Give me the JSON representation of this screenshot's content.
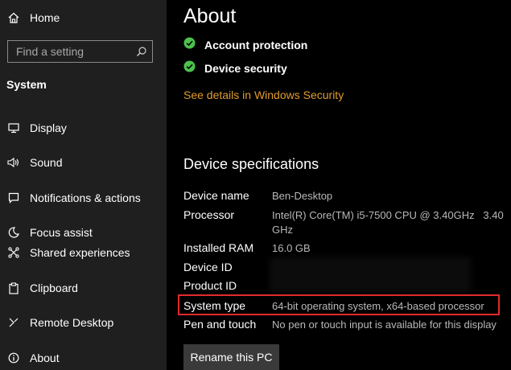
{
  "sidebar": {
    "home_label": "Home",
    "search_placeholder": "Find a setting",
    "section_title": "System",
    "items": [
      {
        "label": "Display",
        "icon": "display-icon"
      },
      {
        "label": "Sound",
        "icon": "speaker-icon"
      },
      {
        "label": "Notifications & actions",
        "icon": "notifications-icon"
      },
      {
        "label": "Focus assist",
        "icon": "moon-icon"
      },
      {
        "label": "Shared experiences",
        "icon": "shared-experiences-icon"
      },
      {
        "label": "Clipboard",
        "icon": "clipboard-icon"
      },
      {
        "label": "Remote Desktop",
        "icon": "remote-desktop-icon"
      },
      {
        "label": "About",
        "icon": "info-icon"
      }
    ]
  },
  "main": {
    "title": "About",
    "security": [
      {
        "label": "Account protection",
        "status_color": "#4cc24c"
      },
      {
        "label": "Device security",
        "status_color": "#4cc24c"
      }
    ],
    "security_link": "See details in Windows Security",
    "specs_heading": "Device specifications",
    "specs": [
      {
        "label": "Device name",
        "value": "Ben-Desktop"
      },
      {
        "label": "Processor",
        "value_line1": "Intel(R) Core(TM) i5-7500 CPU @ 3.40GHz   3.40",
        "value_line2": "GHz"
      },
      {
        "label": "Installed RAM",
        "value": "16.0 GB"
      },
      {
        "label": "Device ID",
        "value": ""
      },
      {
        "label": "Product ID",
        "value": ""
      },
      {
        "label": "System type",
        "value": "64-bit operating system, x64-based processor"
      },
      {
        "label": "Pen and touch",
        "value": "No pen or touch input is available for this display"
      }
    ],
    "rename_button": "Rename this PC"
  },
  "colors": {
    "sidebar_bg": "#1f1f1f",
    "main_bg": "#000000",
    "accent_link": "#e09a2c",
    "highlight_border": "#e12b2b",
    "check_green": "#4cc24c"
  }
}
